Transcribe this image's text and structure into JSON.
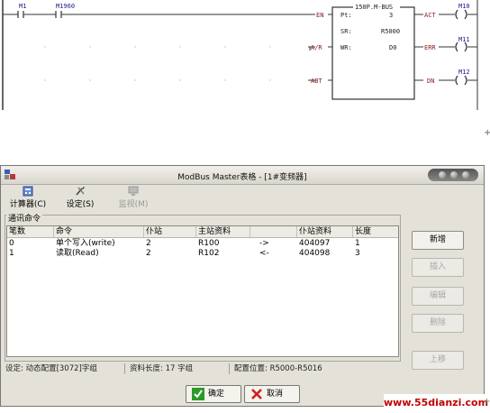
{
  "ladder": {
    "contacts": [
      "M1",
      "M1960"
    ],
    "block_title": "150P.M-BUS",
    "inputs": [
      "EN",
      "A/R",
      "ABT"
    ],
    "params": [
      {
        "label": "Pt:",
        "value": "3"
      },
      {
        "label": "SR:",
        "value": "R5000"
      },
      {
        "label": "WR:",
        "value": "D0"
      }
    ],
    "outputs": [
      "ACT",
      "ERR",
      "DN"
    ],
    "coils": [
      "M10",
      "M11",
      "M12"
    ]
  },
  "dialog": {
    "title": "ModBus Master表格 - [1#变频器]",
    "toolbar": [
      {
        "label": "计算器(C)",
        "icon": "calculator-icon",
        "enabled": true
      },
      {
        "label": "设定(S)",
        "icon": "tools-icon",
        "enabled": true
      },
      {
        "label": "监视(M)",
        "icon": "monitor-icon",
        "enabled": false
      }
    ],
    "group_label": "通讯命令",
    "table": {
      "columns": [
        "笔数",
        "命令",
        "仆站",
        "主站资料",
        "",
        "仆站资料",
        "长度"
      ],
      "rows": [
        [
          "0",
          "单个写入(write)",
          "2",
          "R100",
          "->",
          "404097",
          "1"
        ],
        [
          "1",
          "读取(Read)",
          "2",
          "R102",
          "<-",
          "404098",
          "3"
        ]
      ]
    },
    "side_buttons": [
      {
        "label": "新增",
        "enabled": true
      },
      {
        "label": "插入",
        "enabled": false
      },
      {
        "label": "编辑",
        "enabled": false
      },
      {
        "label": "删除",
        "enabled": false
      },
      {
        "label": "上移",
        "enabled": false
      }
    ],
    "status": {
      "config": "设定: 动态配置[3072]字组",
      "length": "资料长度: 17 字组",
      "position": "配置位置: R5000-R5016"
    },
    "ok_label": "确定",
    "cancel_label": "取消"
  },
  "watermark": "www.55dianzi.com",
  "colors": {
    "ladder_blue": "#1a1a8c",
    "ladder_red": "#8a1a1a",
    "ok_green": "#2a9a2a",
    "cancel_red": "#d02020"
  }
}
